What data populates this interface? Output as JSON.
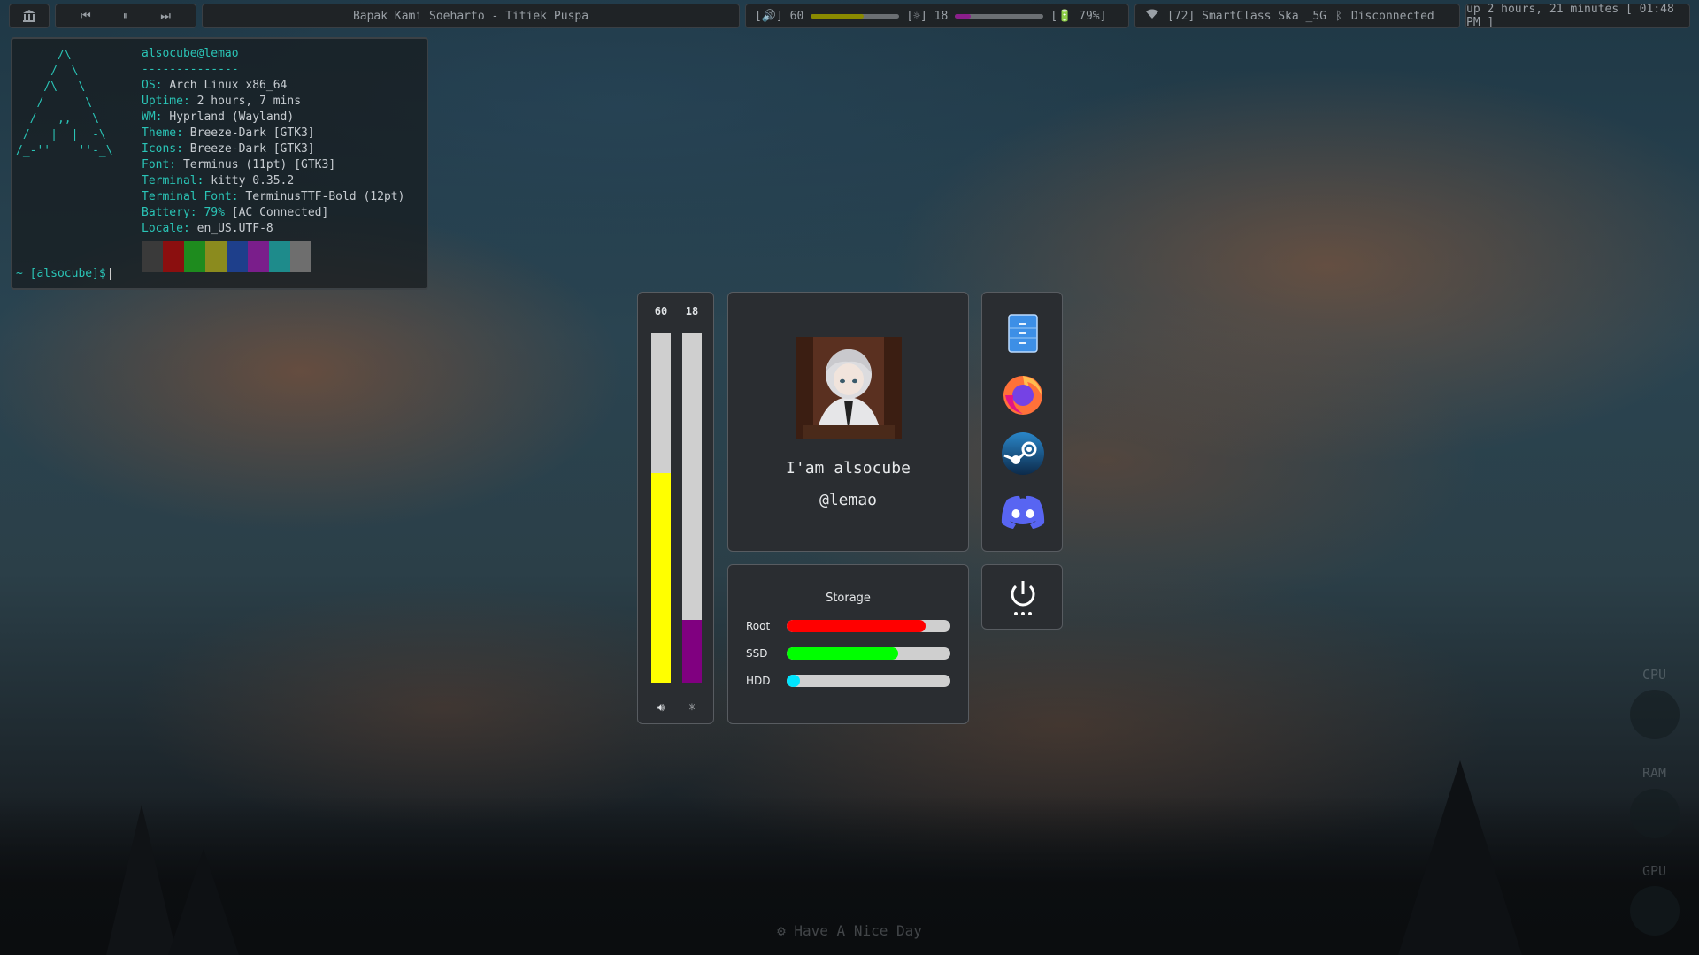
{
  "topbar": {
    "logo_icon": "arch-columns-icon",
    "media": {
      "prev_icon": "skip-previous-icon",
      "pause_icon": "pause-icon",
      "next_icon": "skip-next-icon"
    },
    "now_playing": "Bapak Kami Soeharto - Titiek Puspa",
    "volume": {
      "label": "[🔊] 60",
      "level": 0.6,
      "color": "#8a8a00"
    },
    "brightness": {
      "label": "[☼] 18",
      "level": 0.18,
      "color": "#8b1e8b"
    },
    "battery": {
      "label": "[🔋 79%]"
    },
    "wifi": {
      "icon": "wifi-icon",
      "label": "[72] SmartClass Ska _5G"
    },
    "bluetooth": {
      "icon": "bluetooth-icon",
      "label": "Disconnected"
    },
    "uptime": "up 2 hours, 21 minutes [ 01:48 PM ]"
  },
  "terminal": {
    "ascii_logo": "      /\\\n     /  \\\n    /\\   \\\n   /      \\\n  /   ,,   \\\n /   |  |  -\\\n/_-''    ''-_\\",
    "header": "alsocube@lemao",
    "separator": "--------------",
    "fields": [
      {
        "key": "OS",
        "value": "Arch Linux x86_64"
      },
      {
        "key": "Uptime",
        "value": "2 hours, 7 mins"
      },
      {
        "key": "WM",
        "value": "Hyprland (Wayland)"
      },
      {
        "key": "Theme",
        "value": "Breeze-Dark [GTK3]"
      },
      {
        "key": "Icons",
        "value": "Breeze-Dark [GTK3]"
      },
      {
        "key": "Font",
        "value": "Terminus (11pt) [GTK3]"
      },
      {
        "key": "Terminal",
        "value": "kitty 0.35.2"
      },
      {
        "key": "Terminal Font",
        "value": "TerminusTTF-Bold (12pt)"
      },
      {
        "key": "Battery",
        "value_highlight": "79%",
        "value": " [AC Connected]"
      },
      {
        "key": "Locale",
        "value": "en_US.UTF-8"
      }
    ],
    "palette": [
      "#3a3a3a",
      "#8b0f0f",
      "#1e8b1e",
      "#8b8b1e",
      "#1e3f8b",
      "#7a1e8b",
      "#1e8b8b",
      "#6e6e6e"
    ],
    "prompt": "~ [alsocube]$"
  },
  "sliders": {
    "volume": {
      "value": "60",
      "level": 0.6,
      "color": "#ffff00",
      "icon": "speaker-icon"
    },
    "brightness": {
      "value": "18",
      "level": 0.18,
      "color": "#800080",
      "icon": "sun-icon"
    }
  },
  "profile": {
    "name": "I'am alsocube",
    "handle": "@lemao"
  },
  "storage": {
    "title": "Storage",
    "drives": [
      {
        "label": "Root",
        "level": 0.85,
        "color": "#ff0000"
      },
      {
        "label": "SSD",
        "level": 0.68,
        "color": "#00ff00"
      },
      {
        "label": "HDD",
        "level": 0.08,
        "color": "#00e5ff"
      }
    ]
  },
  "apps": [
    {
      "name": "file-manager-icon"
    },
    {
      "name": "firefox-icon"
    },
    {
      "name": "steam-icon"
    },
    {
      "name": "discord-icon"
    }
  ],
  "power": {
    "icon": "power-icon"
  },
  "gauges": {
    "cpu": "CPU",
    "ram": "RAM",
    "gpu": "GPU"
  },
  "footer": {
    "icon": "gear-icon",
    "message": "Have A Nice Day"
  }
}
